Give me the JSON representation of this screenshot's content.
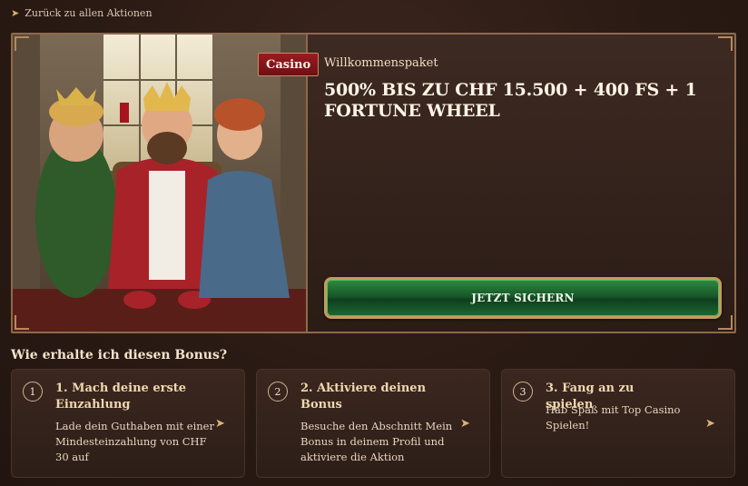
{
  "nav": {
    "back_label": "Zurück zu allen Aktionen",
    "back_icon": "arrow-left-icon"
  },
  "promo": {
    "category_tag": "Casino",
    "label": "Willkommenspaket",
    "title": "500% BIS ZU CHF 15.500 + 400 FS + 1 FORTUNE WHEEL",
    "cta_label": "JETZT SICHERN",
    "colors": {
      "tag": "#8b1a20",
      "cta": "#1f6b33",
      "frame": "#8d6a4a"
    }
  },
  "how_to": {
    "heading": "Wie erhalte ich diesen Bonus?",
    "steps": [
      {
        "number": "1",
        "title": "1. Mach deine erste Einzahlung",
        "description": "Lade dein Guthaben mit einer Mindesteinzahlung von CHF 30 auf",
        "icon": "arrow-right-icon"
      },
      {
        "number": "2",
        "title": "2. Aktiviere deinen Bonus",
        "description": "Besuche den Abschnitt Mein Bonus in deinem Profil und aktiviere die Aktion",
        "icon": "arrow-right-icon"
      },
      {
        "number": "3",
        "title": "3. Fang an zu spielen",
        "description": "Hab Spaß mit Top Casino Spielen!",
        "icon": "arrow-right-icon"
      }
    ]
  }
}
